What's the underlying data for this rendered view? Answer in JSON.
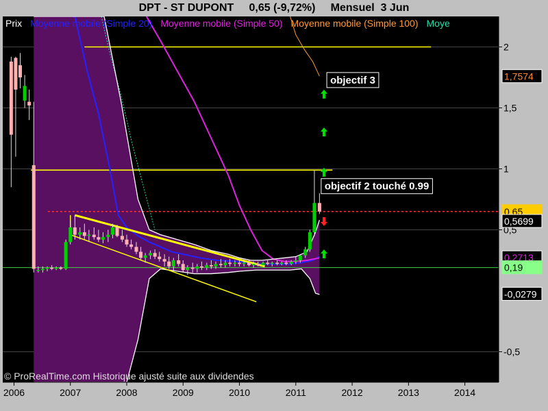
{
  "title": "DPT - ST DUPONT     0,65 (-9,72%)     Mensuel  3 Jun",
  "legend": [
    {
      "label": "Prix",
      "color": "#ffffff"
    },
    {
      "label": "Moyenne mobile (Simple 20)",
      "color": "#2222ff"
    },
    {
      "label": "Moyenne mobile (Simple 50)",
      "color": "#e020e0"
    },
    {
      "label": "Moyenne mobile (Simple 100)",
      "color": "#ff9933"
    },
    {
      "label": "Moye",
      "color": "#22ddaa"
    }
  ],
  "watermark": "© ProRealTime.com Historique ajusté suite aux dividendes",
  "annotations": {
    "objectif3": "objectif 3",
    "objectif2": "objectif 2   touché 0.99"
  },
  "colors": {
    "background": "#000000",
    "bollinger_fill": "#5a1060",
    "up_candle": "#00d000",
    "down_candle": "#ffb0b0",
    "trendline": "#ffff00",
    "current_price_line": "#ff3333",
    "support_line": "#44cc44"
  },
  "chart_data": {
    "type": "candlestick",
    "xlabel": "",
    "ylabel": "",
    "x_ticks": [
      "2006",
      "2007",
      "2008",
      "2009",
      "2010",
      "2011",
      "2012",
      "2013",
      "2014"
    ],
    "y_ticks": [
      "2",
      "1,5",
      "1",
      "0,5",
      "-0,5"
    ],
    "ylim": [
      -0.75,
      2.25
    ],
    "value_badges": [
      {
        "value": "1,7574",
        "bg": "#000000",
        "fg": "#ff8833",
        "border": "#ffffff"
      },
      {
        "value": "0,65",
        "bg": "#ffcc00",
        "fg": "#000000",
        "border": "#ffcc00"
      },
      {
        "value": "0,5699",
        "bg": "#000000",
        "fg": "#ffffff",
        "border": "#ffffff"
      },
      {
        "value": "0,2713",
        "bg": "#000000",
        "fg": "#e020e0",
        "border": "#ffffff"
      },
      {
        "value": "0,19",
        "bg": "#88ff88",
        "fg": "#000000",
        "border": "#88ff88"
      },
      {
        "value": "-0,0279",
        "bg": "#000000",
        "fg": "#ffffff",
        "border": "#ffffff"
      }
    ],
    "horizontal_levels": [
      {
        "name": "objectif 3 level",
        "y": 2.0,
        "x_from": 2007.25,
        "x_to": 2013.4
      },
      {
        "name": "objectif 2 level",
        "y": 0.99,
        "x_from": 2006.3,
        "x_to": 2011.65
      },
      {
        "name": "support",
        "y": 0.19,
        "x_from": 2005.8,
        "x_to": 2014.6
      },
      {
        "name": "current",
        "y": 0.65,
        "x_from": 2006.6,
        "x_to": 2014.6
      }
    ],
    "trendlines": [
      {
        "x1": 2007.08,
        "y1": 0.62,
        "x2": 2010.45,
        "y2": 0.2
      },
      {
        "x1": 2007.0,
        "y1": 0.46,
        "x2": 2010.3,
        "y2": -0.09
      },
      {
        "x1": 2007.0,
        "y1": 0.62,
        "x2": 2007.0,
        "y2": 0.46
      }
    ],
    "arrows": [
      {
        "x": 2011.5,
        "y": 1.61,
        "dir": "up"
      },
      {
        "x": 2011.5,
        "y": 0.97,
        "dir": "up"
      },
      {
        "x": 2011.5,
        "y": 0.3,
        "dir": "up"
      },
      {
        "x": 2011.5,
        "y": 1.3,
        "dir": "up"
      },
      {
        "x": 2011.5,
        "y": 0.57,
        "dir": "down"
      }
    ],
    "candles": [
      {
        "t": 2005.95,
        "o": 1.88,
        "h": 1.92,
        "l": 0.85,
        "c": 1.28
      },
      {
        "t": 2006.03,
        "o": 1.91,
        "h": 1.92,
        "l": 1.1,
        "c": 1.65
      },
      {
        "t": 2006.11,
        "o": 1.85,
        "h": 1.95,
        "l": 1.66,
        "c": 1.75
      },
      {
        "t": 2006.19,
        "o": 1.56,
        "h": 1.77,
        "l": 1.5,
        "c": 1.68
      },
      {
        "t": 2006.27,
        "o": 1.55,
        "h": 1.65,
        "l": 1.4,
        "c": 1.52
      },
      {
        "t": 2006.35,
        "o": 1.03,
        "h": 1.55,
        "l": 0.15,
        "c": 0.18
      },
      {
        "t": 2006.43,
        "o": 0.17,
        "h": 0.2,
        "l": 0.15,
        "c": 0.17
      },
      {
        "t": 2006.51,
        "o": 0.17,
        "h": 0.2,
        "l": 0.15,
        "c": 0.18
      },
      {
        "t": 2006.59,
        "o": 0.18,
        "h": 0.2,
        "l": 0.16,
        "c": 0.19
      },
      {
        "t": 2006.67,
        "o": 0.19,
        "h": 0.21,
        "l": 0.17,
        "c": 0.18
      },
      {
        "t": 2006.75,
        "o": 0.18,
        "h": 0.2,
        "l": 0.17,
        "c": 0.19
      },
      {
        "t": 2006.83,
        "o": 0.19,
        "h": 0.2,
        "l": 0.17,
        "c": 0.18
      },
      {
        "t": 2006.92,
        "o": 0.18,
        "h": 0.42,
        "l": 0.17,
        "c": 0.4
      },
      {
        "t": 2007.0,
        "o": 0.4,
        "h": 0.58,
        "l": 0.38,
        "c": 0.52
      },
      {
        "t": 2007.08,
        "o": 0.52,
        "h": 0.62,
        "l": 0.42,
        "c": 0.46
      },
      {
        "t": 2007.17,
        "o": 0.46,
        "h": 0.52,
        "l": 0.42,
        "c": 0.48
      },
      {
        "t": 2007.25,
        "o": 0.48,
        "h": 0.55,
        "l": 0.42,
        "c": 0.45
      },
      {
        "t": 2007.33,
        "o": 0.45,
        "h": 0.5,
        "l": 0.4,
        "c": 0.46
      },
      {
        "t": 2007.42,
        "o": 0.46,
        "h": 0.52,
        "l": 0.42,
        "c": 0.44
      },
      {
        "t": 2007.5,
        "o": 0.44,
        "h": 0.5,
        "l": 0.4,
        "c": 0.42
      },
      {
        "t": 2007.58,
        "o": 0.42,
        "h": 0.48,
        "l": 0.39,
        "c": 0.44
      },
      {
        "t": 2007.67,
        "o": 0.44,
        "h": 0.5,
        "l": 0.4,
        "c": 0.46
      },
      {
        "t": 2007.75,
        "o": 0.46,
        "h": 0.55,
        "l": 0.43,
        "c": 0.52
      },
      {
        "t": 2007.83,
        "o": 0.52,
        "h": 0.54,
        "l": 0.44,
        "c": 0.45
      },
      {
        "t": 2007.92,
        "o": 0.45,
        "h": 0.5,
        "l": 0.4,
        "c": 0.42
      },
      {
        "t": 2008.0,
        "o": 0.42,
        "h": 0.46,
        "l": 0.36,
        "c": 0.38
      },
      {
        "t": 2008.08,
        "o": 0.38,
        "h": 0.42,
        "l": 0.34,
        "c": 0.36
      },
      {
        "t": 2008.17,
        "o": 0.36,
        "h": 0.4,
        "l": 0.3,
        "c": 0.32
      },
      {
        "t": 2008.25,
        "o": 0.32,
        "h": 0.36,
        "l": 0.25,
        "c": 0.27
      },
      {
        "t": 2008.33,
        "o": 0.27,
        "h": 0.31,
        "l": 0.23,
        "c": 0.29
      },
      {
        "t": 2008.42,
        "o": 0.29,
        "h": 0.33,
        "l": 0.26,
        "c": 0.31
      },
      {
        "t": 2008.5,
        "o": 0.31,
        "h": 0.34,
        "l": 0.26,
        "c": 0.28
      },
      {
        "t": 2008.58,
        "o": 0.28,
        "h": 0.32,
        "l": 0.24,
        "c": 0.26
      },
      {
        "t": 2008.67,
        "o": 0.26,
        "h": 0.3,
        "l": 0.2,
        "c": 0.24
      },
      {
        "t": 2008.75,
        "o": 0.24,
        "h": 0.28,
        "l": 0.18,
        "c": 0.2
      },
      {
        "t": 2008.83,
        "o": 0.2,
        "h": 0.27,
        "l": 0.16,
        "c": 0.25
      },
      {
        "t": 2008.92,
        "o": 0.25,
        "h": 0.3,
        "l": 0.2,
        "c": 0.22
      },
      {
        "t": 2009.0,
        "o": 0.22,
        "h": 0.25,
        "l": 0.15,
        "c": 0.17
      },
      {
        "t": 2009.08,
        "o": 0.17,
        "h": 0.21,
        "l": 0.13,
        "c": 0.19
      },
      {
        "t": 2009.17,
        "o": 0.19,
        "h": 0.23,
        "l": 0.15,
        "c": 0.18
      },
      {
        "t": 2009.25,
        "o": 0.18,
        "h": 0.22,
        "l": 0.15,
        "c": 0.2
      },
      {
        "t": 2009.33,
        "o": 0.2,
        "h": 0.24,
        "l": 0.17,
        "c": 0.19
      },
      {
        "t": 2009.42,
        "o": 0.19,
        "h": 0.23,
        "l": 0.17,
        "c": 0.21
      },
      {
        "t": 2009.5,
        "o": 0.21,
        "h": 0.25,
        "l": 0.18,
        "c": 0.2
      },
      {
        "t": 2009.58,
        "o": 0.2,
        "h": 0.24,
        "l": 0.18,
        "c": 0.22
      },
      {
        "t": 2009.67,
        "o": 0.22,
        "h": 0.26,
        "l": 0.19,
        "c": 0.21
      },
      {
        "t": 2009.75,
        "o": 0.21,
        "h": 0.25,
        "l": 0.19,
        "c": 0.23
      },
      {
        "t": 2009.83,
        "o": 0.23,
        "h": 0.26,
        "l": 0.2,
        "c": 0.22
      },
      {
        "t": 2009.92,
        "o": 0.22,
        "h": 0.25,
        "l": 0.2,
        "c": 0.23
      },
      {
        "t": 2010.0,
        "o": 0.23,
        "h": 0.25,
        "l": 0.2,
        "c": 0.22
      },
      {
        "t": 2010.08,
        "o": 0.22,
        "h": 0.24,
        "l": 0.2,
        "c": 0.23
      },
      {
        "t": 2010.17,
        "o": 0.23,
        "h": 0.25,
        "l": 0.2,
        "c": 0.21
      },
      {
        "t": 2010.25,
        "o": 0.21,
        "h": 0.24,
        "l": 0.19,
        "c": 0.22
      },
      {
        "t": 2010.33,
        "o": 0.22,
        "h": 0.24,
        "l": 0.2,
        "c": 0.21
      },
      {
        "t": 2010.42,
        "o": 0.21,
        "h": 0.24,
        "l": 0.2,
        "c": 0.23
      },
      {
        "t": 2010.5,
        "o": 0.23,
        "h": 0.25,
        "l": 0.21,
        "c": 0.22
      },
      {
        "t": 2010.58,
        "o": 0.22,
        "h": 0.24,
        "l": 0.2,
        "c": 0.23
      },
      {
        "t": 2010.67,
        "o": 0.23,
        "h": 0.25,
        "l": 0.21,
        "c": 0.22
      },
      {
        "t": 2010.75,
        "o": 0.22,
        "h": 0.24,
        "l": 0.21,
        "c": 0.23
      },
      {
        "t": 2010.83,
        "o": 0.23,
        "h": 0.25,
        "l": 0.21,
        "c": 0.22
      },
      {
        "t": 2010.92,
        "o": 0.22,
        "h": 0.25,
        "l": 0.21,
        "c": 0.24
      },
      {
        "t": 2011.0,
        "o": 0.24,
        "h": 0.28,
        "l": 0.22,
        "c": 0.25
      },
      {
        "t": 2011.08,
        "o": 0.25,
        "h": 0.3,
        "l": 0.23,
        "c": 0.29
      },
      {
        "t": 2011.17,
        "o": 0.29,
        "h": 0.36,
        "l": 0.27,
        "c": 0.34
      },
      {
        "t": 2011.25,
        "o": 0.34,
        "h": 0.5,
        "l": 0.32,
        "c": 0.48
      },
      {
        "t": 2011.33,
        "o": 0.48,
        "h": 0.99,
        "l": 0.45,
        "c": 0.72
      },
      {
        "t": 2011.42,
        "o": 0.72,
        "h": 0.8,
        "l": 0.63,
        "c": 0.65
      }
    ],
    "series": [
      {
        "name": "Moyenne mobile (Simple 20)",
        "color": "#2222ff",
        "x": [
          2007.08,
          2007.3,
          2007.5,
          2007.7,
          2007.85,
          2008.0,
          2008.2,
          2008.4,
          2008.6,
          2008.8,
          2009.0,
          2009.3,
          2009.6,
          2010.0,
          2010.3,
          2010.6,
          2010.9,
          2011.1,
          2011.3,
          2011.42
        ],
        "values": [
          2.25,
          1.8,
          1.45,
          1.0,
          0.62,
          0.52,
          0.45,
          0.4,
          0.36,
          0.32,
          0.3,
          0.27,
          0.25,
          0.24,
          0.22,
          0.22,
          0.22,
          0.23,
          0.25,
          0.28
        ]
      },
      {
        "name": "Moyenne mobile (Simple 50)",
        "color": "#e020e0",
        "x": [
          2008.35,
          2008.6,
          2008.9,
          2009.2,
          2009.5,
          2009.8,
          2010.0,
          2010.2,
          2010.4,
          2010.6,
          2010.8,
          2011.0,
          2011.2,
          2011.42
        ],
        "values": [
          2.25,
          2.05,
          1.8,
          1.55,
          1.25,
          0.95,
          0.7,
          0.5,
          0.33,
          0.26,
          0.24,
          0.24,
          0.25,
          0.27
        ]
      },
      {
        "name": "Moyenne mobile (Simple 100)",
        "color": "#ff9933",
        "x": [
          2010.9,
          2011.0,
          2011.15,
          2011.3,
          2011.42
        ],
        "values": [
          2.25,
          2.1,
          1.98,
          1.88,
          1.76
        ]
      },
      {
        "name": "Moye",
        "color": "#22ddaa",
        "x": [
          2007.55,
          2007.7,
          2007.9,
          2008.1,
          2008.3,
          2008.5
        ],
        "values": [
          2.25,
          1.95,
          1.6,
          1.2,
          0.85,
          0.5
        ]
      },
      {
        "name": "Bollinger upper",
        "color": "#ffffff",
        "x": [
          2006.35,
          2006.5,
          2006.7,
          2006.85,
          2007.0,
          2007.3,
          2007.6,
          2007.9,
          2008.2,
          2008.4,
          2008.6,
          2008.9,
          2009.2,
          2009.5,
          2009.8,
          2010.0,
          2010.2,
          2010.4,
          2010.6,
          2010.8,
          2011.0,
          2011.2,
          2011.35,
          2011.42
        ],
        "values": [
          2.25,
          2.25,
          2.25,
          2.25,
          2.25,
          2.25,
          2.25,
          1.55,
          0.75,
          0.5,
          0.46,
          0.42,
          0.38,
          0.33,
          0.3,
          0.27,
          0.25,
          0.25,
          0.26,
          0.27,
          0.28,
          0.32,
          0.48,
          0.58
        ]
      },
      {
        "name": "Bollinger lower",
        "color": "#ffffff",
        "x": [
          2006.35,
          2006.5,
          2006.7,
          2006.85,
          2007.0,
          2007.2,
          2007.5,
          2007.8,
          2008.0,
          2008.2,
          2008.4,
          2008.6,
          2008.9,
          2009.2,
          2009.5,
          2009.8,
          2010.0,
          2010.3,
          2010.6,
          2010.9,
          2011.1,
          2011.25,
          2011.35,
          2011.42
        ],
        "values": [
          -0.75,
          -0.75,
          -0.75,
          -0.75,
          -0.75,
          -0.75,
          -0.75,
          -0.75,
          -0.75,
          -0.4,
          0.1,
          0.18,
          0.16,
          0.14,
          0.14,
          0.15,
          0.16,
          0.17,
          0.17,
          0.17,
          0.18,
          0.1,
          -0.02,
          -0.03
        ]
      }
    ]
  }
}
